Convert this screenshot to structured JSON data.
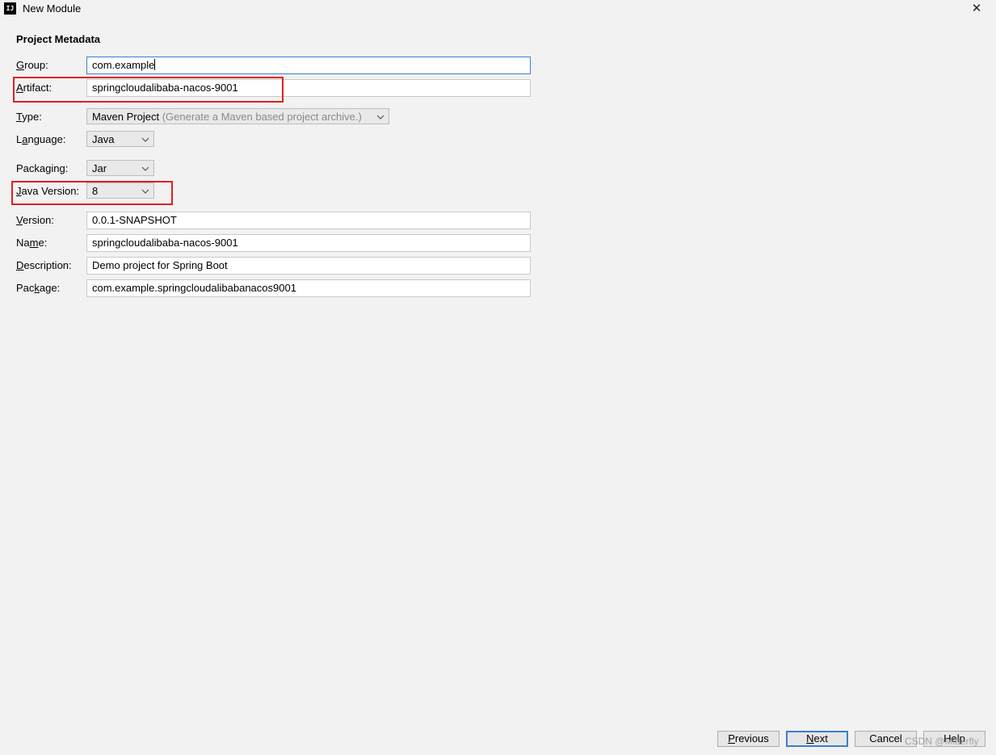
{
  "window": {
    "app_icon": "IJ",
    "title": "New Module",
    "close_glyph": "✕"
  },
  "section": {
    "title": "Project Metadata"
  },
  "form": {
    "group": {
      "label_mnemonic": "G",
      "label_rest": "roup:",
      "value": "com.example"
    },
    "artifact": {
      "label_mnemonic": "A",
      "label_rest": "rtifact:",
      "value": "springcloudalibaba-nacos-9001"
    },
    "type": {
      "label_mnemonic": "T",
      "label_rest": "ype:",
      "value": "Maven Project",
      "hint": "(Generate a Maven based project archive.)"
    },
    "language": {
      "label_pre": "L",
      "label_mnemonic": "a",
      "label_rest": "nguage:",
      "value": "Java"
    },
    "packaging": {
      "label_pre": "Packa",
      "label_mnemonic": "g",
      "label_rest": "ing:",
      "value": "Jar"
    },
    "java_version": {
      "label_mnemonic": "J",
      "label_rest": "ava Version:",
      "value": "8"
    },
    "version": {
      "label_mnemonic": "V",
      "label_rest": "ersion:",
      "value": "0.0.1-SNAPSHOT"
    },
    "name": {
      "label_pre": "Na",
      "label_mnemonic": "m",
      "label_rest": "e:",
      "value": "springcloudalibaba-nacos-9001"
    },
    "description": {
      "label_mnemonic": "D",
      "label_rest": "escription:",
      "value": "Demo project for Spring Boot"
    },
    "package": {
      "label_pre": "Pac",
      "label_mnemonic": "k",
      "label_rest": "age:",
      "value": "com.example.springcloudalibabanacos9001"
    }
  },
  "buttons": {
    "previous": {
      "mnemonic": "P",
      "rest": "revious"
    },
    "next": {
      "mnemonic": "N",
      "rest": "ext"
    },
    "cancel": "Cancel",
    "help": "Help"
  },
  "watermark": "CSDN @Mitterfly",
  "colors": {
    "annotation_red": "#e02020",
    "focus_blue": "#3a7fcf",
    "background": "#f2f2f2"
  },
  "icons": {
    "app": "intellij-icon",
    "close": "close-icon",
    "dropdown": "chevron-down-icon"
  }
}
